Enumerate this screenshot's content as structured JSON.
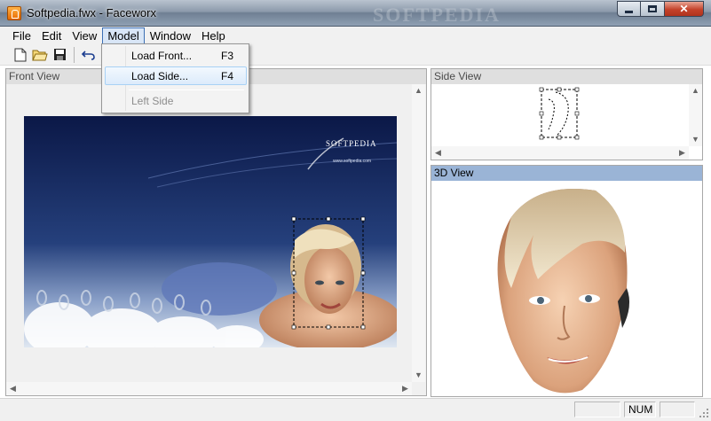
{
  "window": {
    "title": "Softpedia.fwx - Faceworx",
    "watermark": "SOFTPEDIA",
    "minimize_icon": "minimize-icon",
    "maximize_icon": "maximize-icon",
    "close_icon": "close-icon",
    "close_glyph": "✕"
  },
  "menubar": {
    "items": [
      "File",
      "Edit",
      "View",
      "Model",
      "Window",
      "Help"
    ],
    "active": "Model"
  },
  "toolbar": {
    "icons": [
      "new-document-icon",
      "open-folder-icon",
      "save-disk-icon",
      "undo-icon"
    ]
  },
  "model_menu": {
    "items": [
      {
        "label": "Load Front...",
        "shortcut": "F3"
      },
      {
        "label": "Load Side...",
        "shortcut": "F4"
      },
      {
        "label": "Left Side",
        "shortcut": ""
      }
    ],
    "highlighted": "Load Side...",
    "disabled": "Left Side"
  },
  "panes": {
    "front": {
      "title": "Front View"
    },
    "side": {
      "title": "Side View"
    },
    "three_d": {
      "title": "3D View"
    }
  },
  "front_image": {
    "logo_text": "SOFTPEDIA",
    "url_text": "www.softpedia.com"
  },
  "statusbar": {
    "message": "",
    "num": "NUM"
  },
  "colors": {
    "active_pane_title": "#9ab4d6",
    "menu_highlight": "#d9e6f7"
  }
}
